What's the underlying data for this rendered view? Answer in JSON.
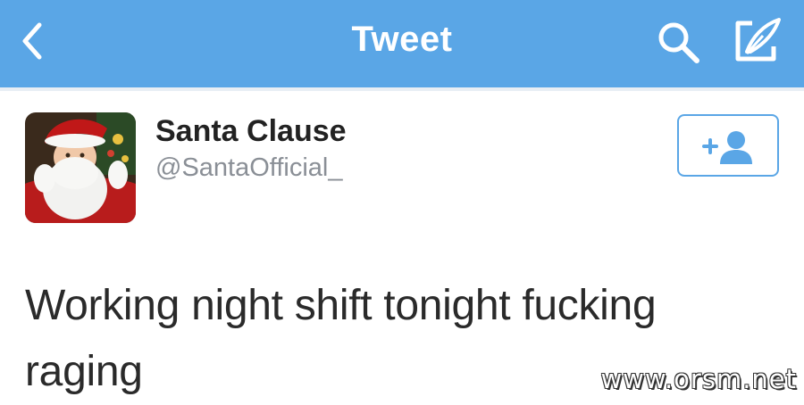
{
  "header": {
    "title": "Tweet",
    "back_icon": "chevron-left-icon",
    "search_icon": "search-icon",
    "compose_icon": "compose-icon"
  },
  "tweet": {
    "author_name": "Santa Clause",
    "author_handle": "@SantaOfficial_",
    "text": "Working night shift tonight fucking raging",
    "follow_icon": "add-user-icon"
  },
  "watermark": "www.orsm.net",
  "colors": {
    "accent": "#5aa6e6",
    "text": "#2a2a2a",
    "muted": "#8a8f96"
  }
}
